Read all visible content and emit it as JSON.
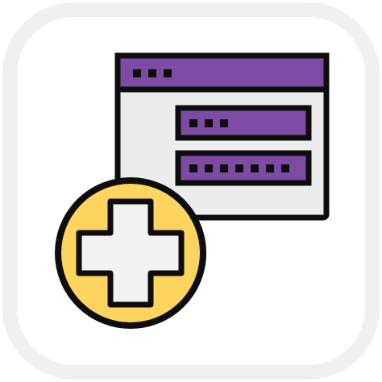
{
  "icon": {
    "name": "add-login-form-icon",
    "colors": {
      "tile_border": "#f0f0f0",
      "tile_fill": "#ffffff",
      "outline": "#0d0d0d",
      "window_bg": "#ececec",
      "accent_purple": "#7d4ba3",
      "plus_circle": "#fcd45e",
      "plus_sign": "#f2f2f2"
    },
    "title_bar_dots": 3,
    "fields": [
      {
        "name": "username-field",
        "dots": 3
      },
      {
        "name": "password-field",
        "dots": 7
      }
    ]
  }
}
